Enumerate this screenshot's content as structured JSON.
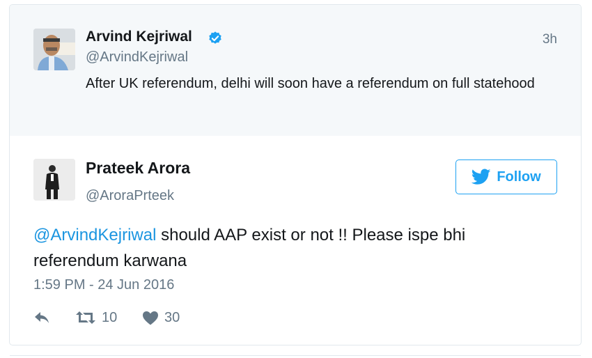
{
  "parent_tweet": {
    "author_name": "Arvind Kejriwal",
    "author_handle": "@ArvindKejriwal",
    "verified_icon": "verified-badge-icon",
    "time_ago": "3h",
    "text": "After UK referendum, delhi will soon have a referendum on full statehood"
  },
  "reply_tweet": {
    "author_name": "Prateek Arora",
    "author_handle": "@AroraPrteek",
    "follow_label": "Follow",
    "mention": "@ArvindKejriwal",
    "text": " should AAP exist or not !! Please ispe bhi referendum karwana",
    "timestamp": "1:59 PM - 24 Jun 2016",
    "actions": {
      "reply_icon": "reply-icon",
      "retweet_icon": "retweet-icon",
      "retweet_count": "10",
      "like_icon": "heart-icon",
      "like_count": "30"
    }
  },
  "colors": {
    "accent": "#1da1f2",
    "link": "#1b95e0",
    "muted": "#657786",
    "parent_bg": "#f5f8fa"
  }
}
